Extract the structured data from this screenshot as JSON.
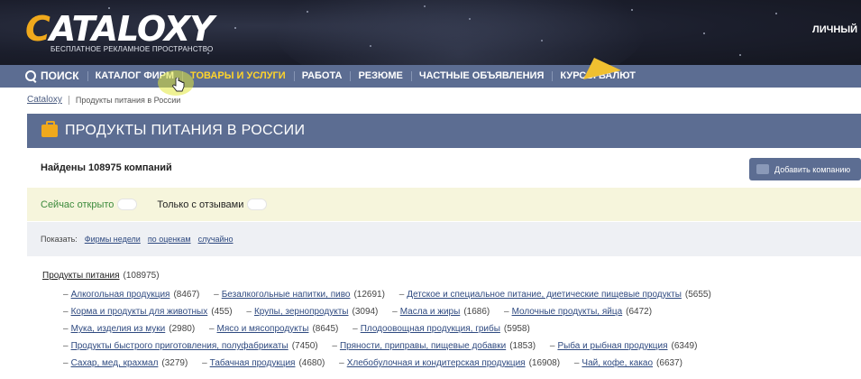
{
  "header": {
    "logo_text": "CATALOXY",
    "logo_tagline": "БЕСПЛАТНОЕ РЕКЛАМНОЕ ПРОСТРАНСТВО",
    "personal_label": "ЛИЧНЫЙ"
  },
  "nav": {
    "search": "ПОИСК",
    "items": [
      "КАТАЛОГ ФИРМ",
      "ТОВАРЫ И УСЛУГИ",
      "РАБОТА",
      "РЕЗЮМЕ",
      "ЧАСТНЫЕ ОБЪЯВЛЕНИЯ",
      "КУРСЫ ВАЛЮТ"
    ]
  },
  "breadcrumb": {
    "home": "Cataloxy",
    "current": "Продукты питания в России"
  },
  "page_title": "ПРОДУКТЫ ПИТАНИЯ В РОССИИ",
  "found_text": "Найдены 108975 компаний",
  "add_company": "Добавить компанию",
  "filters": {
    "open_now": "Сейчас открыто",
    "with_reviews": "Только с отзывами"
  },
  "show": {
    "label": "Показать:",
    "links": [
      "Фирмы недели",
      "по оценкам",
      "случайно"
    ]
  },
  "category": {
    "name": "Продукты питания",
    "count": "(108975)"
  },
  "subcategories": [
    [
      {
        "name": "Алкогольная продукция",
        "count": "(8467)"
      },
      {
        "name": "Безалкогольные напитки, пиво",
        "count": "(12691)"
      },
      {
        "name": "Детское и специальное питание, диетические пищевые продукты",
        "count": "(5655)"
      }
    ],
    [
      {
        "name": "Корма и продукты для животных",
        "count": "(455)"
      },
      {
        "name": "Крупы, зернопродукты",
        "count": "(3094)"
      },
      {
        "name": "Масла и жиры",
        "count": "(1686)"
      },
      {
        "name": "Молочные продукты, яйца",
        "count": "(6472)"
      }
    ],
    [
      {
        "name": "Мука, изделия из муки",
        "count": "(2980)"
      },
      {
        "name": "Мясо и мясопродукты",
        "count": "(8645)"
      },
      {
        "name": "Плодоовощная продукция, грибы",
        "count": "(5958)"
      }
    ],
    [
      {
        "name": "Продукты быстрого приготовления, полуфабрикаты",
        "count": "(7450)"
      },
      {
        "name": "Пряности, приправы, пищевые добавки",
        "count": "(1853)"
      },
      {
        "name": "Рыба и рыбная продукция",
        "count": "(6349)"
      }
    ],
    [
      {
        "name": "Сахар, мед, крахмал",
        "count": "(3279)"
      },
      {
        "name": "Табачная продукция",
        "count": "(4680)"
      },
      {
        "name": "Хлебобулочная и кондитерская продукция",
        "count": "(16908)"
      },
      {
        "name": "Чай, кофе, какао",
        "count": "(6637)"
      }
    ]
  ],
  "colors": {
    "nav": "#5c6d92",
    "accent": "#f0a91c",
    "active_nav": "#ffd42a",
    "filter_bg": "#f6f5dc"
  }
}
